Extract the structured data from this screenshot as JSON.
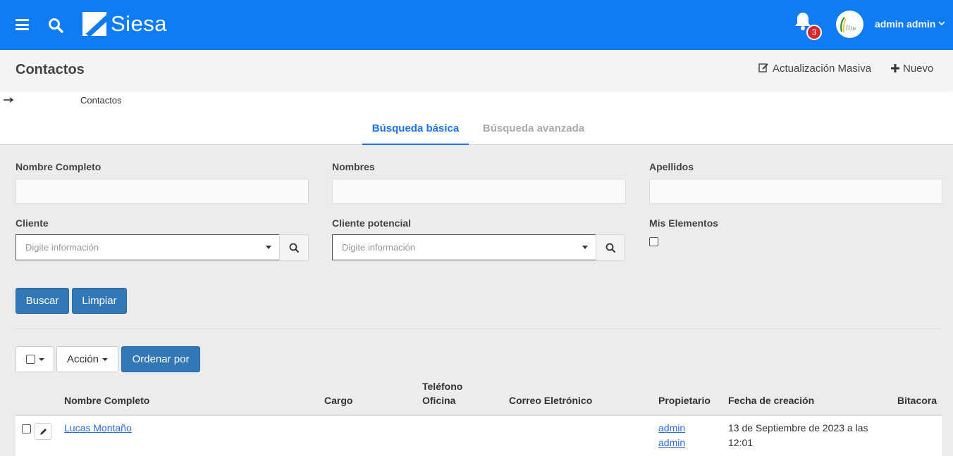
{
  "topbar": {
    "brand": "Siesa",
    "notification_count": "3",
    "user_name": "admin admin",
    "colors": {
      "bar": "#0f7cf3",
      "badge": "#d9262e"
    },
    "icons": [
      "menu-icon",
      "search-icon",
      "bell-icon",
      "chevron-down-icon"
    ]
  },
  "header": {
    "title": "Contactos",
    "bulk_update_label": "Actualización Masiva",
    "new_label": "Nuevo"
  },
  "breadcrumb": {
    "current": "Contactos"
  },
  "tabs": [
    {
      "label": "Búsqueda básica",
      "active": true
    },
    {
      "label": "Búsqueda avanzada",
      "active": false
    }
  ],
  "filters": {
    "full_name_label": "Nombre Completo",
    "full_name_value": "",
    "names_label": "Nombres",
    "names_value": "",
    "last_names_label": "Apellidos",
    "last_names_value": "",
    "client_label": "Cliente",
    "client_placeholder": "Digite información",
    "prospect_label": "Cliente potencial",
    "prospect_placeholder": "Digite información",
    "my_items_label": "Mis Elementos",
    "my_items_checked": false
  },
  "buttons": {
    "search": "Buscar",
    "clear": "Limpiar",
    "action": "Acción",
    "sort_by": "Ordenar por"
  },
  "table": {
    "columns": [
      "Nombre Completo",
      "Cargo",
      "Teléfono Oficina",
      "Correo Eletrónico",
      "Propietario",
      "Fecha de creación",
      "Bitacora"
    ],
    "phone_col_line1": "Teléfono",
    "phone_col_line2": "Oficina",
    "rows": [
      {
        "full_name": "Lucas Montaño",
        "position": "",
        "office_phone": "",
        "email": "",
        "owner_line1": "admin",
        "owner_line2": "admin",
        "created_line1": "13 de Septiembre de 2023 a las",
        "created_line2": "12:01",
        "log": ""
      }
    ]
  }
}
